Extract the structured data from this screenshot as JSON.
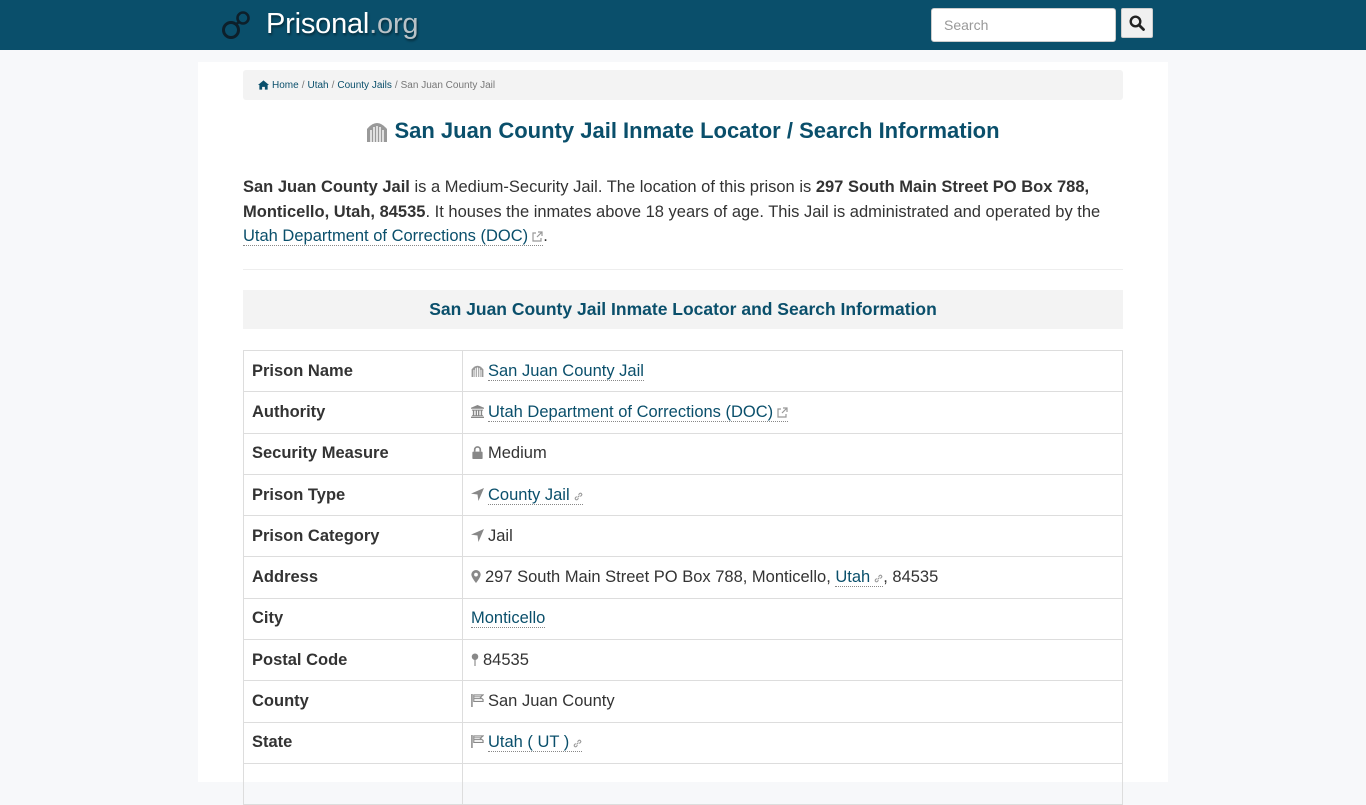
{
  "brand": {
    "name": "Prisonal",
    "tld": ".org",
    "icon": "handcuffs-icon"
  },
  "search": {
    "placeholder": "Search",
    "button_icon": "search-icon"
  },
  "breadcrumb": {
    "items": [
      {
        "label": "Home",
        "icon": "home-icon"
      },
      {
        "label": "Utah"
      },
      {
        "label": "County Jails"
      }
    ],
    "current": "San Juan County Jail",
    "separator": "/"
  },
  "page": {
    "title": "San Juan County Jail Inmate Locator / Search Information",
    "title_icon": "jail-icon"
  },
  "intro": {
    "name": "San Juan County Jail",
    "t1": " is a Medium-Security Jail. The location of this prison is ",
    "address": "297 South Main Street PO Box 788, Monticello, Utah, 84535",
    "t2": ". It houses the inmates above 18 years of age. This Jail is administrated and operated by the ",
    "authority_link": "Utah Department of Corrections (DOC)",
    "t3": "."
  },
  "section": {
    "title": "San Juan County Jail Inmate Locator and Search Information"
  },
  "table": {
    "rows": [
      {
        "key": "Prison Name",
        "value": "San Juan County Jail",
        "icon": "jail-icon",
        "link": true
      },
      {
        "key": "Authority",
        "value": "Utah Department of Corrections (DOC)",
        "icon": "institution-icon",
        "link": true,
        "external": true
      },
      {
        "key": "Security Measure",
        "value": "Medium",
        "icon": "lock-icon"
      },
      {
        "key": "Prison Type",
        "value": "County Jail",
        "icon": "location-arrow-icon",
        "link": true,
        "chain": true
      },
      {
        "key": "Prison Category",
        "value": "Jail",
        "icon": "location-arrow-icon"
      },
      {
        "key": "Address",
        "value_pre": "297 South Main Street PO Box 788, Monticello, ",
        "value_link": "Utah",
        "value_post": ", 84535",
        "icon": "map-marker-icon"
      },
      {
        "key": "City",
        "value": "Monticello",
        "link": true
      },
      {
        "key": "Postal Code",
        "value": "84535",
        "icon": "map-pin-icon"
      },
      {
        "key": "County",
        "value": "San Juan County",
        "icon": "flag-icon"
      },
      {
        "key": "State",
        "value": "Utah ( UT )",
        "icon": "flag-icon",
        "link": true,
        "chain": true
      }
    ]
  }
}
